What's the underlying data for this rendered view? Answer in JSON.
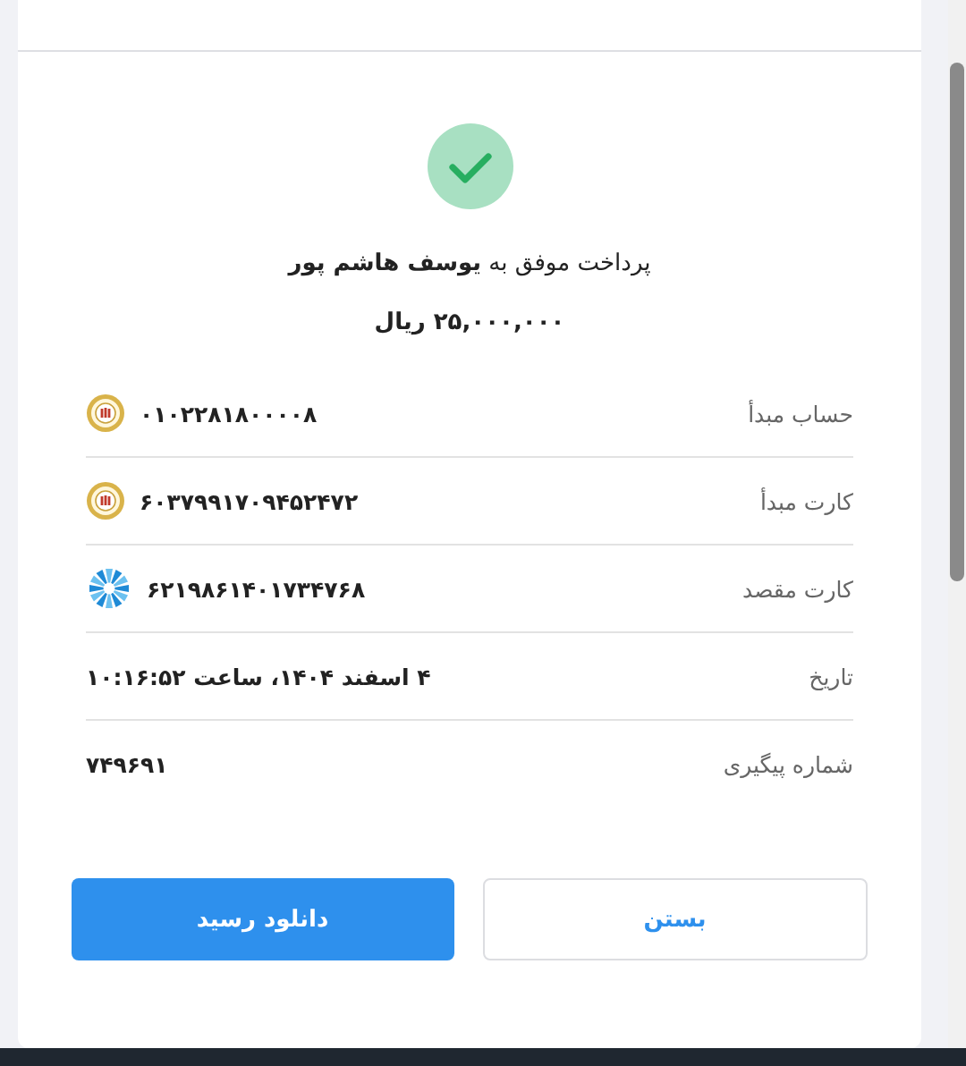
{
  "receipt": {
    "title": "پرداخت موفق به **یوسف هاشم پور**",
    "amount": "۲۵,۰۰۰,۰۰۰ ریال",
    "rows": [
      {
        "label": "حساب مبدأ",
        "value": "۰۱۰۲۲۸۱۸۰۰۰۰۸",
        "kind": "emblem"
      },
      {
        "label": "کارت مبدأ",
        "value": "۶۰۳۷۹۹۱۷۰۹۴۵۲۴۷۲",
        "kind": "emblem"
      },
      {
        "label": "کارت مقصد",
        "value": "۶۲۱۹۸۶۱۴۰۱۷۳۴۷۶۸",
        "kind": "flower"
      },
      {
        "label": "تاریخ",
        "value": "۴ اسفند ۱۴۰۴، ساعت ۱۰:۱۶:۵۲",
        "kind": "plain"
      },
      {
        "label": "شماره پیگیری",
        "value": "۷۴۹۶۹۱",
        "kind": "plain"
      }
    ],
    "buttons": [
      {
        "label": "بستن",
        "kind": "outline"
      },
      {
        "label": "دانلود رسید",
        "kind": "primary"
      }
    ]
  }
}
